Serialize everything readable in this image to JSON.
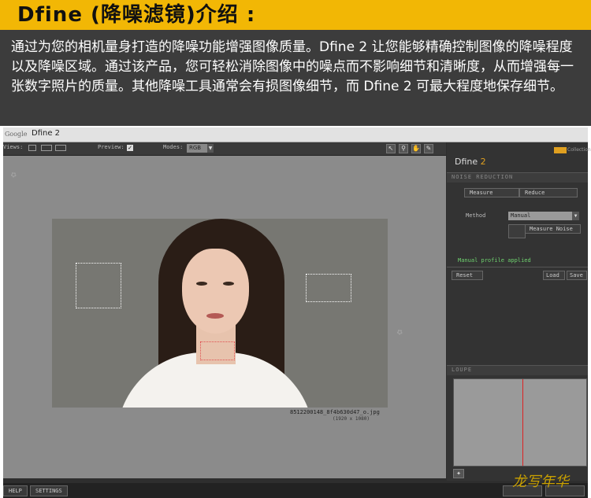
{
  "banner": {
    "title": "Dfine (降噪滤镜)介绍 :",
    "bg_color": "#f2b705"
  },
  "intro": {
    "text": "通过为您的相机量身打造的降噪功能增强图像质量。Dfine 2 让您能够精确控制图像的降噪程度以及降噪区域。通过该产品，您可轻松消除图像中的噪点而不影响细节和清晰度，从而增强每一张数字照片的质量。其他降噪工具通常会有损图像细节，而 Dfine 2 可最大程度地保存细节。"
  },
  "app": {
    "brand_tab": "Google",
    "window_title": "Dfine 2",
    "toolbar": {
      "views_label": "Views:",
      "preview_label": "Preview:",
      "preview_checked": "✓",
      "modes_label": "Modes:",
      "mode_value": "RGB"
    },
    "image": {
      "filename": "8512200148_8f4b630d47_o.jpg",
      "dimensions": "(1920 x 1080)"
    },
    "panel": {
      "product": "Dfine",
      "version": "2",
      "collection": "Collection",
      "section_noise": "NOISE REDUCTION",
      "measure_label": "Measure",
      "reduce_label": "Reduce",
      "method_label": "Method",
      "method_value": "Manual",
      "measure_noise_label": "Measure Noise",
      "status": "Manual profile applied",
      "reset_label": "Reset",
      "load_label": "Load",
      "save_label": "Save",
      "section_loupe": "LOUPE"
    },
    "bottom": {
      "help_label": "HELP",
      "settings_label": "SETTINGS"
    }
  },
  "watermarks": {
    "site": "龙写年华"
  }
}
